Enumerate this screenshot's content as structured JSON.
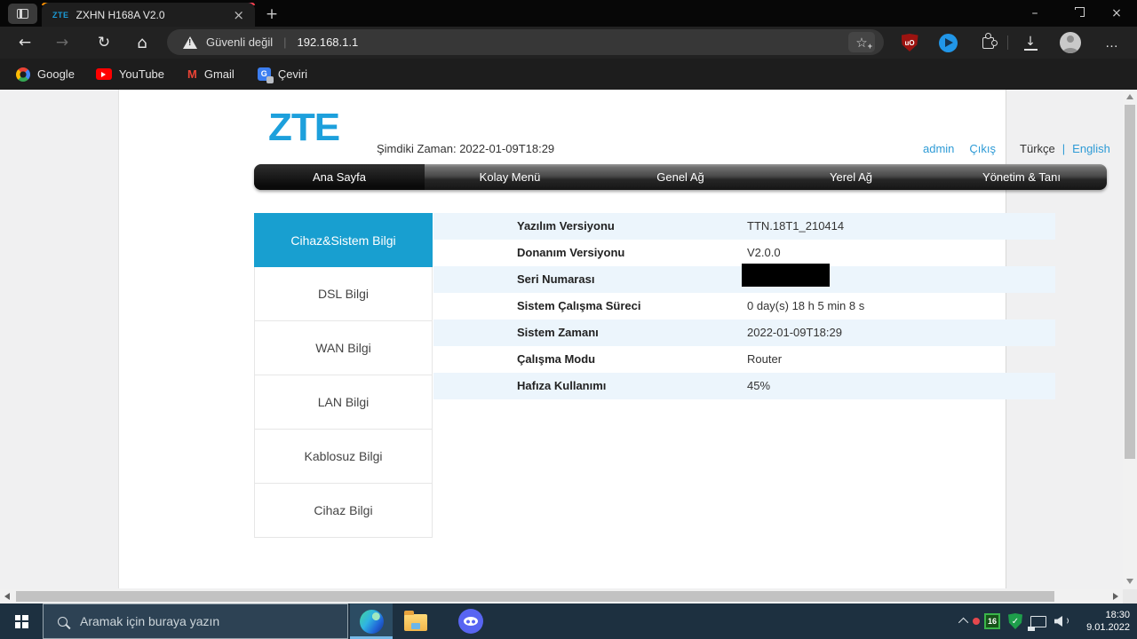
{
  "colors": {
    "accent_teal": "#189fd0",
    "row_highlight_blue": "#ecf5fc",
    "link_blue": "#2e9bd6",
    "logo_blue": "#1da0dc",
    "taskbar_bg": "#1d3040",
    "ublock_red": "#9c1310",
    "discord_blurple": "#5865f2",
    "security_green": "#1e9e4b"
  },
  "browser": {
    "tab": {
      "favicon_text": "ZTE",
      "title": "ZXHN H168A V2.0"
    },
    "address": {
      "security_label": "Güvenli değil",
      "url": "192.168.1.1"
    },
    "bookmarks": [
      {
        "label": "Google"
      },
      {
        "label": "YouTube"
      },
      {
        "label": "Gmail"
      },
      {
        "label": "Çeviri"
      }
    ]
  },
  "page": {
    "logo_text": "ZTE",
    "current_time": "Şimdiki Zaman: 2022-01-09T18:29",
    "session": {
      "user": "admin",
      "logout": "Çıkış",
      "language_current": "Türkçe",
      "language_divider": "|",
      "language_alt": "English"
    },
    "nav": [
      {
        "label": "Ana Sayfa",
        "active": true
      },
      {
        "label": "Kolay Menü",
        "active": false
      },
      {
        "label": "Genel Ağ",
        "active": false
      },
      {
        "label": "Yerel Ağ",
        "active": false
      },
      {
        "label": "Yönetim & Tanı",
        "active": false
      }
    ],
    "sidebar": [
      {
        "label": "Cihaz&Sistem Bilgi",
        "active": true
      },
      {
        "label": "DSL Bilgi",
        "active": false
      },
      {
        "label": "WAN Bilgi",
        "active": false
      },
      {
        "label": "LAN Bilgi",
        "active": false
      },
      {
        "label": "Kablosuz Bilgi",
        "active": false
      },
      {
        "label": "Cihaz Bilgi",
        "active": false
      }
    ],
    "info_rows": [
      {
        "label": "Yazılım Versiyonu",
        "value": "TTN.18T1_210414"
      },
      {
        "label": "Donanım Versiyonu",
        "value": "V2.0.0"
      },
      {
        "label": "Seri Numarası",
        "value": "",
        "redacted": true
      },
      {
        "label": "Sistem Çalışma Süreci",
        "value": "0 day(s) 18 h 5 min 8 s"
      },
      {
        "label": "Sistem Zamanı",
        "value": "2022-01-09T18:29"
      },
      {
        "label": "Çalışma Modu",
        "value": "Router"
      },
      {
        "label": "Hafıza Kullanımı",
        "value": "45%"
      }
    ]
  },
  "taskbar": {
    "search_placeholder": "Aramak için buraya yazın",
    "tray": {
      "ublock_badge": "16",
      "time": "18:30",
      "date": "9.01.2022"
    }
  }
}
